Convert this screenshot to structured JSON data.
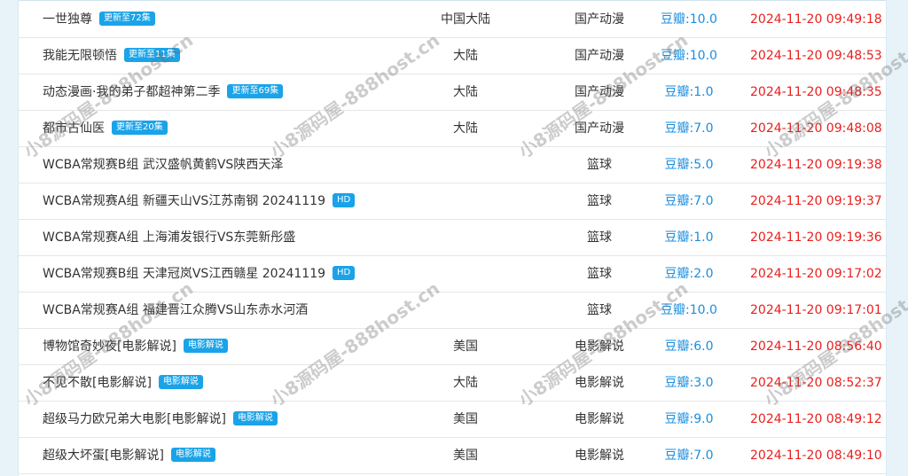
{
  "list": {
    "rows": [
      {
        "title": "一世独尊",
        "badge": "更新至72集",
        "area": "中国大陆",
        "type": "国产动漫",
        "score": "豆瓣:10.0",
        "time": "2024-11-20 09:49:18"
      },
      {
        "title": "我能无限顿悟",
        "badge": "更新至11集",
        "area": "大陆",
        "type": "国产动漫",
        "score": "豆瓣:10.0",
        "time": "2024-11-20 09:48:53"
      },
      {
        "title": "动态漫画·我的弟子都超神第二季",
        "badge": "更新至69集",
        "area": "大陆",
        "type": "国产动漫",
        "score": "豆瓣:1.0",
        "time": "2024-11-20 09:48:35"
      },
      {
        "title": "都市古仙医",
        "badge": "更新至20集",
        "area": "大陆",
        "type": "国产动漫",
        "score": "豆瓣:7.0",
        "time": "2024-11-20 09:48:08"
      },
      {
        "title": "WCBA常规赛B组 武汉盛帆黄鹤VS陕西天泽",
        "badge": "",
        "area": "",
        "type": "篮球",
        "score": "豆瓣:5.0",
        "time": "2024-11-20 09:19:38"
      },
      {
        "title": "WCBA常规赛A组 新疆天山VS江苏南钢 20241119",
        "badge": "HD",
        "area": "",
        "type": "篮球",
        "score": "豆瓣:7.0",
        "time": "2024-11-20 09:19:37"
      },
      {
        "title": "WCBA常规赛A组 上海浦发银行VS东莞新彤盛",
        "badge": "",
        "area": "",
        "type": "篮球",
        "score": "豆瓣:1.0",
        "time": "2024-11-20 09:19:36"
      },
      {
        "title": "WCBA常规赛B组 天津冠岚VS江西赣星 20241119",
        "badge": "HD",
        "area": "",
        "type": "篮球",
        "score": "豆瓣:2.0",
        "time": "2024-11-20 09:17:02"
      },
      {
        "title": "WCBA常规赛A组 福建晋江众腾VS山东赤水河酒",
        "badge": "",
        "area": "",
        "type": "篮球",
        "score": "豆瓣:10.0",
        "time": "2024-11-20 09:17:01"
      },
      {
        "title": "博物馆奇妙夜[电影解说]",
        "badge": "电影解说",
        "area": "美国",
        "type": "电影解说",
        "score": "豆瓣:6.0",
        "time": "2024-11-20 08:56:40"
      },
      {
        "title": "不见不散[电影解说]",
        "badge": "电影解说",
        "area": "大陆",
        "type": "电影解说",
        "score": "豆瓣:3.0",
        "time": "2024-11-20 08:52:37"
      },
      {
        "title": "超级马力欧兄弟大电影[电影解说]",
        "badge": "电影解说",
        "area": "美国",
        "type": "电影解说",
        "score": "豆瓣:9.0",
        "time": "2024-11-20 08:49:12"
      },
      {
        "title": "超级大坏蛋[电影解说]",
        "badge": "电影解说",
        "area": "美国",
        "type": "电影解说",
        "score": "豆瓣:7.0",
        "time": "2024-11-20 08:49:10"
      }
    ]
  },
  "watermark": {
    "text": "小8源码屋-888host.cn"
  },
  "colors": {
    "badge": "#1aa3e8",
    "score": "#1a8ee0",
    "time": "#e8201d",
    "page_bg": "#e7f3f8"
  }
}
